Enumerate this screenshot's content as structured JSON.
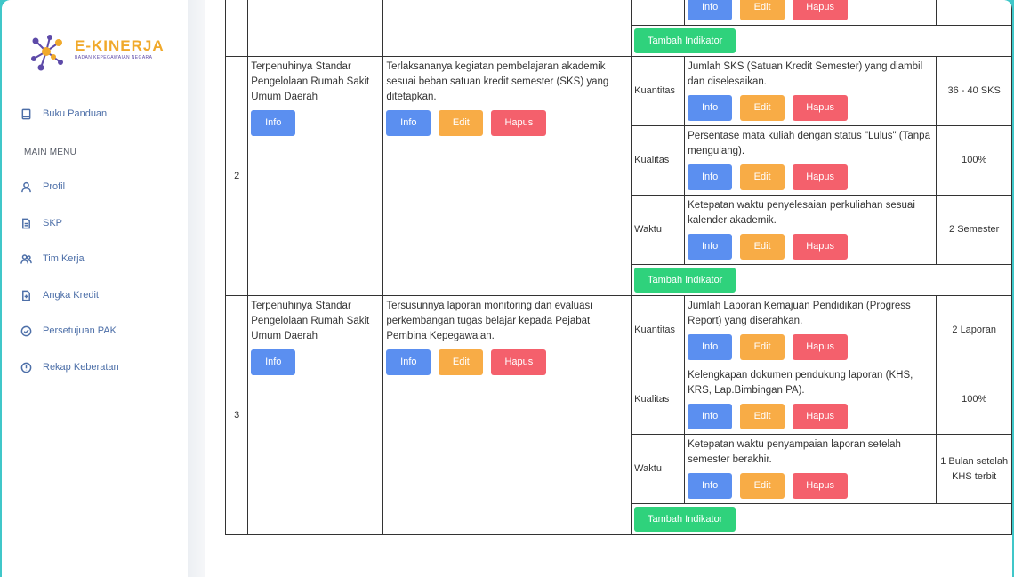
{
  "brand": {
    "name": "E-KINERJA",
    "subtitle": "BADAN KEPEGAWAIAN NEGARA"
  },
  "sidebar": {
    "top_item": "Buku Panduan",
    "menu_heading": "MAIN MENU",
    "items": [
      "Profil",
      "SKP",
      "Tim Kerja",
      "Angka Kredit",
      "Persetujuan PAK",
      "Rekap Keberatan"
    ]
  },
  "buttons": {
    "info": "Info",
    "edit": "Edit",
    "hapus": "Hapus",
    "tambah": "Tambah Indikator"
  },
  "rows": [
    {
      "no": "2",
      "rencana_kerja": "Terpenuhinya Standar Pengelolaan Rumah Sakit Umum Daerah",
      "kegiatan": "Terlaksananya kegiatan pembelajaran akademik sesuai beban satuan kredit semester (SKS) yang ditetapkan.",
      "indikator": [
        {
          "aspek": "Kuantitas",
          "text": "Jumlah SKS (Satuan Kredit Semester) yang diambil dan diselesaikan.",
          "target": "36 - 40 SKS"
        },
        {
          "aspek": "Kualitas",
          "text": "Persentase mata kuliah dengan status \"Lulus\" (Tanpa mengulang).",
          "target": "100%"
        },
        {
          "aspek": "Waktu",
          "text": "Ketepatan waktu penyelesaian perkuliahan sesuai kalender akademik.",
          "target": "2 Semester"
        }
      ]
    },
    {
      "no": "3",
      "rencana_kerja": "Terpenuhinya Standar Pengelolaan Rumah Sakit Umum Daerah",
      "kegiatan": "Tersusunnya laporan monitoring dan evaluasi perkembangan tugas belajar kepada Pejabat Pembina Kepegawaian.",
      "indikator": [
        {
          "aspek": "Kuantitas",
          "text": "Jumlah Laporan Kemajuan Pendidikan (Progress Report) yang diserahkan.",
          "target": "2 Laporan"
        },
        {
          "aspek": "Kualitas",
          "text": "Kelengkapan dokumen pendukung laporan (KHS, KRS, Lap.Bimbingan PA).",
          "target": "100%"
        },
        {
          "aspek": "Waktu",
          "text": "Ketepatan waktu penyampaian laporan setelah semester berakhir.",
          "target": "1 Bulan setelah KHS terbit"
        }
      ]
    }
  ],
  "colors": {
    "info": "#5b8ff0",
    "edit": "#f8ac46",
    "hapus": "#f4606c",
    "tambah": "#2fd27c",
    "frame": "#40c7c9"
  }
}
